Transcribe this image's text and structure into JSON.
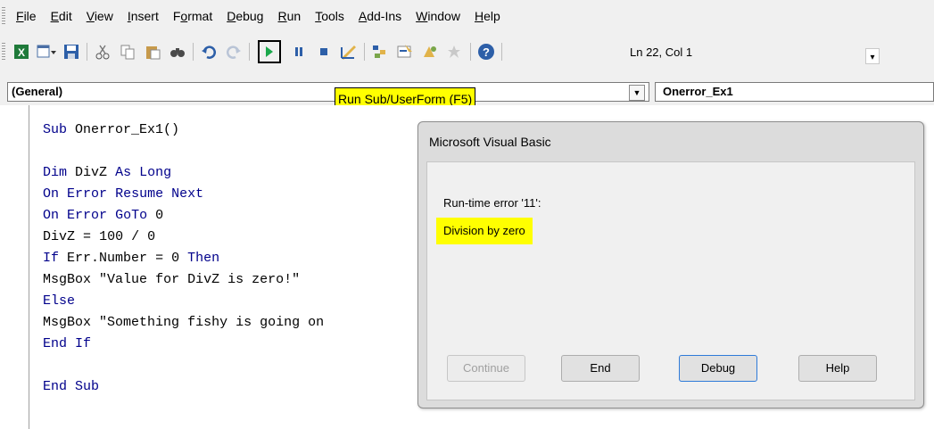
{
  "menu": [
    {
      "label": "File",
      "key": "F"
    },
    {
      "label": "Edit",
      "key": "E"
    },
    {
      "label": "View",
      "key": "V"
    },
    {
      "label": "Insert",
      "key": "I"
    },
    {
      "label": "Format",
      "key": "o"
    },
    {
      "label": "Debug",
      "key": "D"
    },
    {
      "label": "Run",
      "key": "R"
    },
    {
      "label": "Tools",
      "key": "T"
    },
    {
      "label": "Add-Ins",
      "key": "A"
    },
    {
      "label": "Window",
      "key": "W"
    },
    {
      "label": "Help",
      "key": "H"
    }
  ],
  "toolbar": {
    "cursor_position": "Ln 22, Col 1",
    "icons": [
      "excel-icon",
      "insert-userform-icon",
      "save-icon",
      "cut-icon",
      "copy-icon",
      "paste-icon",
      "find-icon",
      "undo-icon",
      "redo-icon",
      "run-icon",
      "break-icon",
      "reset-icon",
      "design-mode-icon",
      "project-explorer-icon",
      "properties-icon",
      "object-browser-icon",
      "toolbox-icon",
      "help-icon"
    ],
    "run_tooltip": "Run Sub/UserForm (F5)"
  },
  "object_combo": {
    "value": "(General)"
  },
  "procedure_combo": {
    "value": "Onerror_Ex1"
  },
  "code_lines": [
    "Sub Onerror_Ex1()",
    "",
    "Dim DivZ As Long",
    "On Error Resume Next",
    "On Error GoTo 0",
    "DivZ = 100 / 0",
    "If Err.Number = 0 Then",
    "MsgBox \"Value for DivZ is zero!\"",
    "Else",
    "MsgBox \"Something fishy is going on",
    "End If",
    "",
    "End Sub"
  ],
  "dialog": {
    "title": "Microsoft Visual Basic",
    "error_code": "Run-time error '11':",
    "error_message": "Division by zero",
    "buttons": {
      "continue": "Continue",
      "end": "End",
      "debug": "Debug",
      "help": "Help"
    }
  },
  "colors": {
    "highlight": "#ffff00",
    "keyword": "#00008b",
    "run_green": "#1aa84b"
  }
}
